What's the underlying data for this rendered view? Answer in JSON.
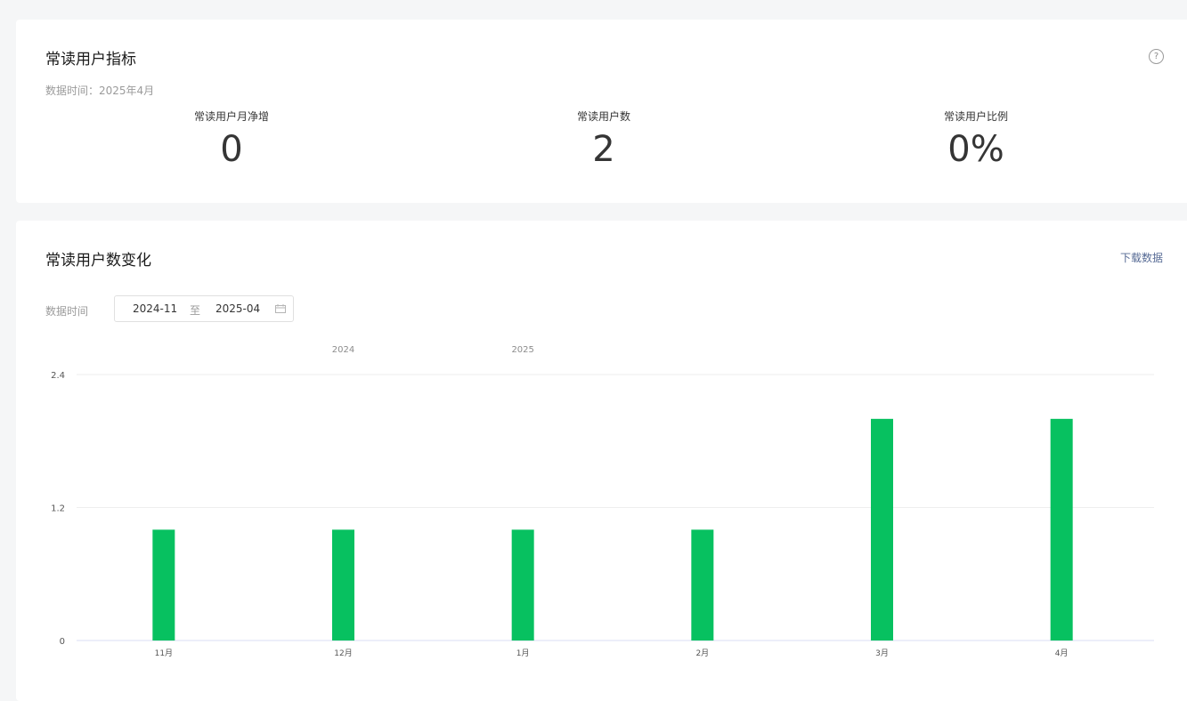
{
  "metrics_card": {
    "title": "常读用户指标",
    "data_time": "数据时间：2025年4月",
    "help_icon": "question-circle-icon",
    "metrics": [
      {
        "label": "常读用户月净增",
        "value": "0"
      },
      {
        "label": "常读用户数",
        "value": "2"
      },
      {
        "label": "常读用户比例",
        "value": "0%"
      }
    ]
  },
  "trend_card": {
    "title": "常读用户数变化",
    "download_label": "下载数据",
    "range_label": "数据时间",
    "range_start": "2024-11",
    "range_separator": "至",
    "range_end": "2025-04",
    "calendar_icon": "calendar-icon"
  },
  "colors": {
    "bar": "#07c160",
    "link": "#576b95",
    "grid": "#eeeeee",
    "axis": "#d9dcf5"
  },
  "chart_data": {
    "type": "bar",
    "categories": [
      "11月",
      "12月",
      "1月",
      "2月",
      "3月",
      "4月"
    ],
    "year_labels": [
      {
        "year": "2024",
        "category_index": 1
      },
      {
        "year": "2025",
        "category_index": 2
      }
    ],
    "values": [
      1,
      1,
      1,
      1,
      2,
      2
    ],
    "ylim": [
      0,
      2.4
    ],
    "yticks": [
      "0",
      "1.2",
      "2.4"
    ],
    "grid": true
  }
}
